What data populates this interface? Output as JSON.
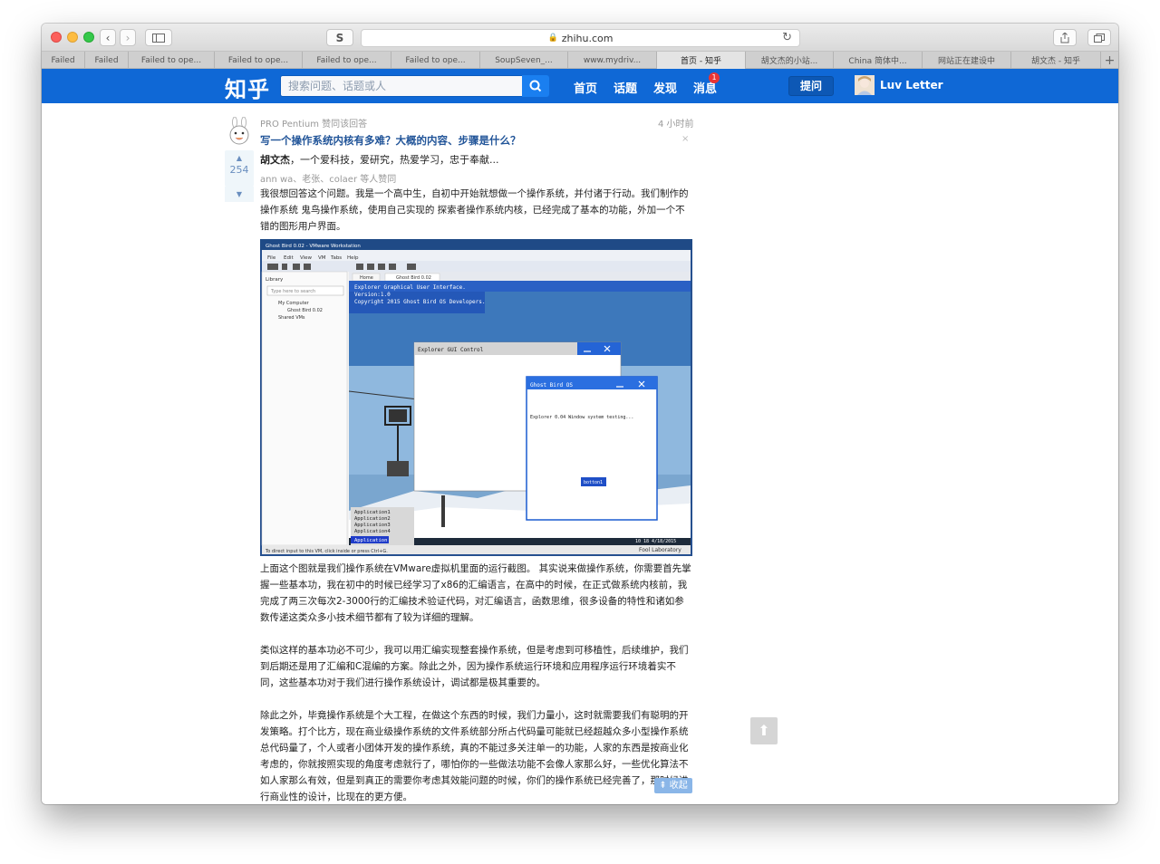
{
  "browser": {
    "url": "zhihu.com",
    "tabs": [
      {
        "label": "Failed",
        "active": false
      },
      {
        "label": "Failed",
        "active": false
      },
      {
        "label": "Failed to ope...",
        "active": false
      },
      {
        "label": "Failed to ope...",
        "active": false
      },
      {
        "label": "Failed to ope...",
        "active": false
      },
      {
        "label": "Failed to ope...",
        "active": false
      },
      {
        "label": "SoupSeven_...",
        "active": false
      },
      {
        "label": "www.mydriv...",
        "active": false
      },
      {
        "label": "首页 - 知乎",
        "active": true
      },
      {
        "label": "胡文杰的小站...",
        "active": false
      },
      {
        "label": "China 简体中...",
        "active": false
      },
      {
        "label": "网站正在建设中",
        "active": false
      },
      {
        "label": "胡文杰 - 知乎",
        "active": false
      }
    ],
    "sidebar_btn_glyph": "S",
    "add_tab_glyph": "+"
  },
  "nav": {
    "logo": "知乎",
    "search_placeholder": "搜索问题、话题或人",
    "links": [
      "首页",
      "话题",
      "发现",
      "消息"
    ],
    "message_badge": "1",
    "ask_button": "提问",
    "username": "Luv Letter"
  },
  "feed": {
    "activity": "PRO Pentium 赞同该回答",
    "time": "4 小时前",
    "question_title": "写一个操作系统内核有多难？大概的内容、步骤是什么？",
    "author_name": "胡文杰",
    "author_bio": "，一个爱科技，爱研究，热爱学习，忠于奉献...",
    "voters": "ann wa、老张、colaer 等人赞同",
    "vote_count": "254",
    "close_glyph": "×",
    "paragraphs": [
      "我很想回答这个问题。我是一个高中生，自初中开始就想做一个操作系统，并付诸于行动。我们制作的操作系统 鬼鸟操作系统，使用自己实现的 探索者操作系统内核，已经完成了基本的功能，外加一个不错的图形用户界面。",
      "上面这个图就是我们操作系统在VMware虚拟机里面的运行截图。 其实说来做操作系统，你需要首先掌握一些基本功，我在初中的时候已经学习了x86的汇编语言，在高中的时候，在正式做系统内核前，我完成了两三次每次2-3000行的汇编技术验证代码，对汇编语言，函数思维，很多设备的特性和诸如参数传递这类众多小技术细节都有了较为详细的理解。",
      "类似这样的基本功必不可少，我可以用汇编实现整套操作系统，但是考虑到可移植性，后续维护，我们到后期还是用了汇编和C混编的方案。除此之外，因为操作系统运行环境和应用程序运行环境着实不同，这些基本功对于我们进行操作系统设计，调试都是极其重要的。",
      "除此之外，毕竟操作系统是个大工程，在做这个东西的时候，我们力量小，这时就需要我们有聪明的开发策略。打个比方，现在商业级操作系统的文件系统部分所占代码量可能就已经超越众多小型操作系统总代码量了，个人或者小团体开发的操作系统，真的不能过多关注单一的功能，人家的东西是按商业化考虑的，你就按照实现的角度考虑就行了，哪怕你的一些做法功能不会像人家那么好，一些优化算法不如人家那么有效，但是到真正的需要你考虑其效能问题的时候，你们的操作系统已经完善了，那时候进行商业性的设计，比现在的更方便。"
    ],
    "collapse_label": "收起"
  },
  "screenshot": {
    "window_title": "Ghost Bird 0.02 - VMware Workstation",
    "menu": [
      "File",
      "Edit",
      "View",
      "VM",
      "Tabs",
      "Help"
    ],
    "library_title": "Library",
    "library_search": "Type here to search",
    "library_items": [
      "My Computer",
      "Ghost Bird 0.02",
      "Shared VMs"
    ],
    "vm_tabs": [
      "Home",
      "Ghost Bird 0.02"
    ],
    "console_lines": [
      "Explorer Graphical User Interface.",
      "Version:1.0",
      "Copyright 2015 Ghost Bird OS Developers."
    ],
    "win1_title": "Explorer GUI Control",
    "win2_title": "Ghost Bird OS",
    "win2_text": "Explorer 0.04 Window system testing...",
    "win2_button": "botton1",
    "app_list": [
      "Application1",
      "Application2",
      "Application3",
      "Application4",
      "Application"
    ],
    "clock": "10 18 4/18/2015",
    "watermark": "Fool Laboratory",
    "status_bar": "To direct input to this VM, click inside or press Ctrl+G."
  }
}
